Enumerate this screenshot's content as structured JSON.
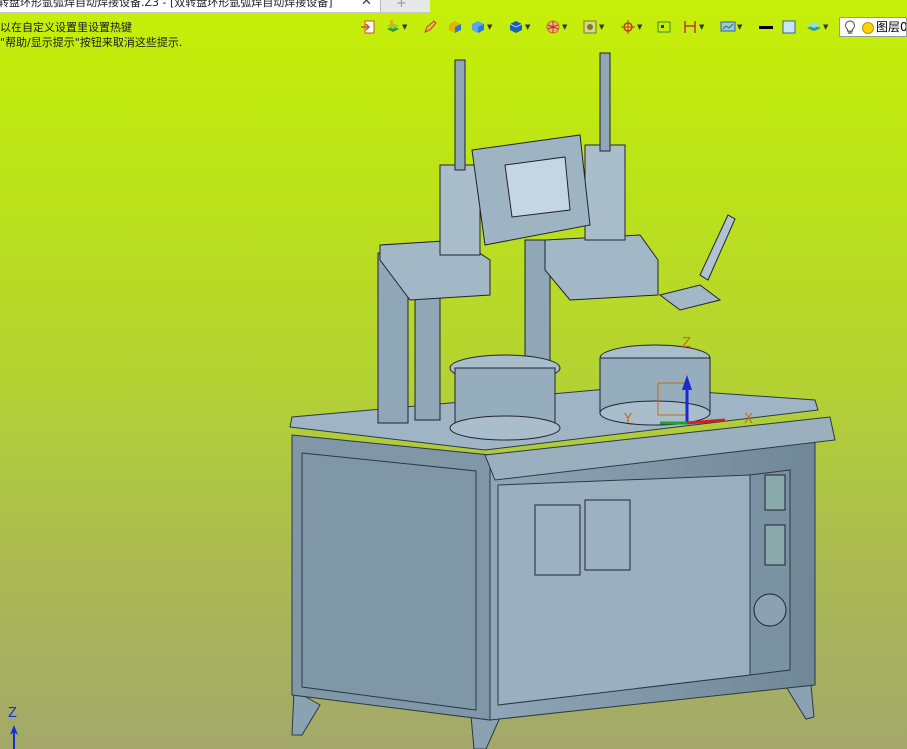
{
  "window": {
    "tab_title": "转盘环形氩弧焊自动焊接设备.Z3 - [双转盘环形氩弧焊自动焊接设备]",
    "tab_close": "✕",
    "tab_new": "+"
  },
  "hints": [
    "以在自定义设置里设置热键",
    "\"帮助/显示提示\"按钮来取消这些提示."
  ],
  "toolbar": {
    "tools": [
      {
        "name": "exit-sketch-icon",
        "color": "#d05020"
      },
      {
        "name": "layer-paint-icon",
        "color": "#3a9a2a"
      },
      {
        "name": "pencil-edit-icon",
        "color": "#c43a2a"
      },
      {
        "name": "color-cube-icon",
        "color": "#e2b400"
      },
      {
        "name": "solid-cube-icon",
        "color": "#2d7bd0"
      },
      {
        "name": "render-mode-icon",
        "color": "#1e5fb0"
      },
      {
        "name": "section-view-icon",
        "color": "#d26a1a"
      },
      {
        "name": "view-frame-icon",
        "color": "#7a7a2a"
      },
      {
        "name": "snap-target-icon",
        "color": "#c0392b"
      },
      {
        "name": "wireframe-icon",
        "color": "#333333"
      },
      {
        "name": "dimension-icon",
        "color": "#c0392b"
      },
      {
        "name": "screen-capture-icon",
        "color": "#336699"
      },
      {
        "name": "line-width-icon",
        "color": "#000000"
      },
      {
        "name": "fill-color-icon",
        "color": "#87ceeb"
      },
      {
        "name": "layer-stack-icon",
        "color": "#20a0a0"
      }
    ],
    "layer_label": "图层0"
  },
  "triad": {
    "axis_label": "Z"
  },
  "model": {
    "gizmo_z": "Z",
    "gizmo_x": "X",
    "gizmo_y": "Y"
  }
}
